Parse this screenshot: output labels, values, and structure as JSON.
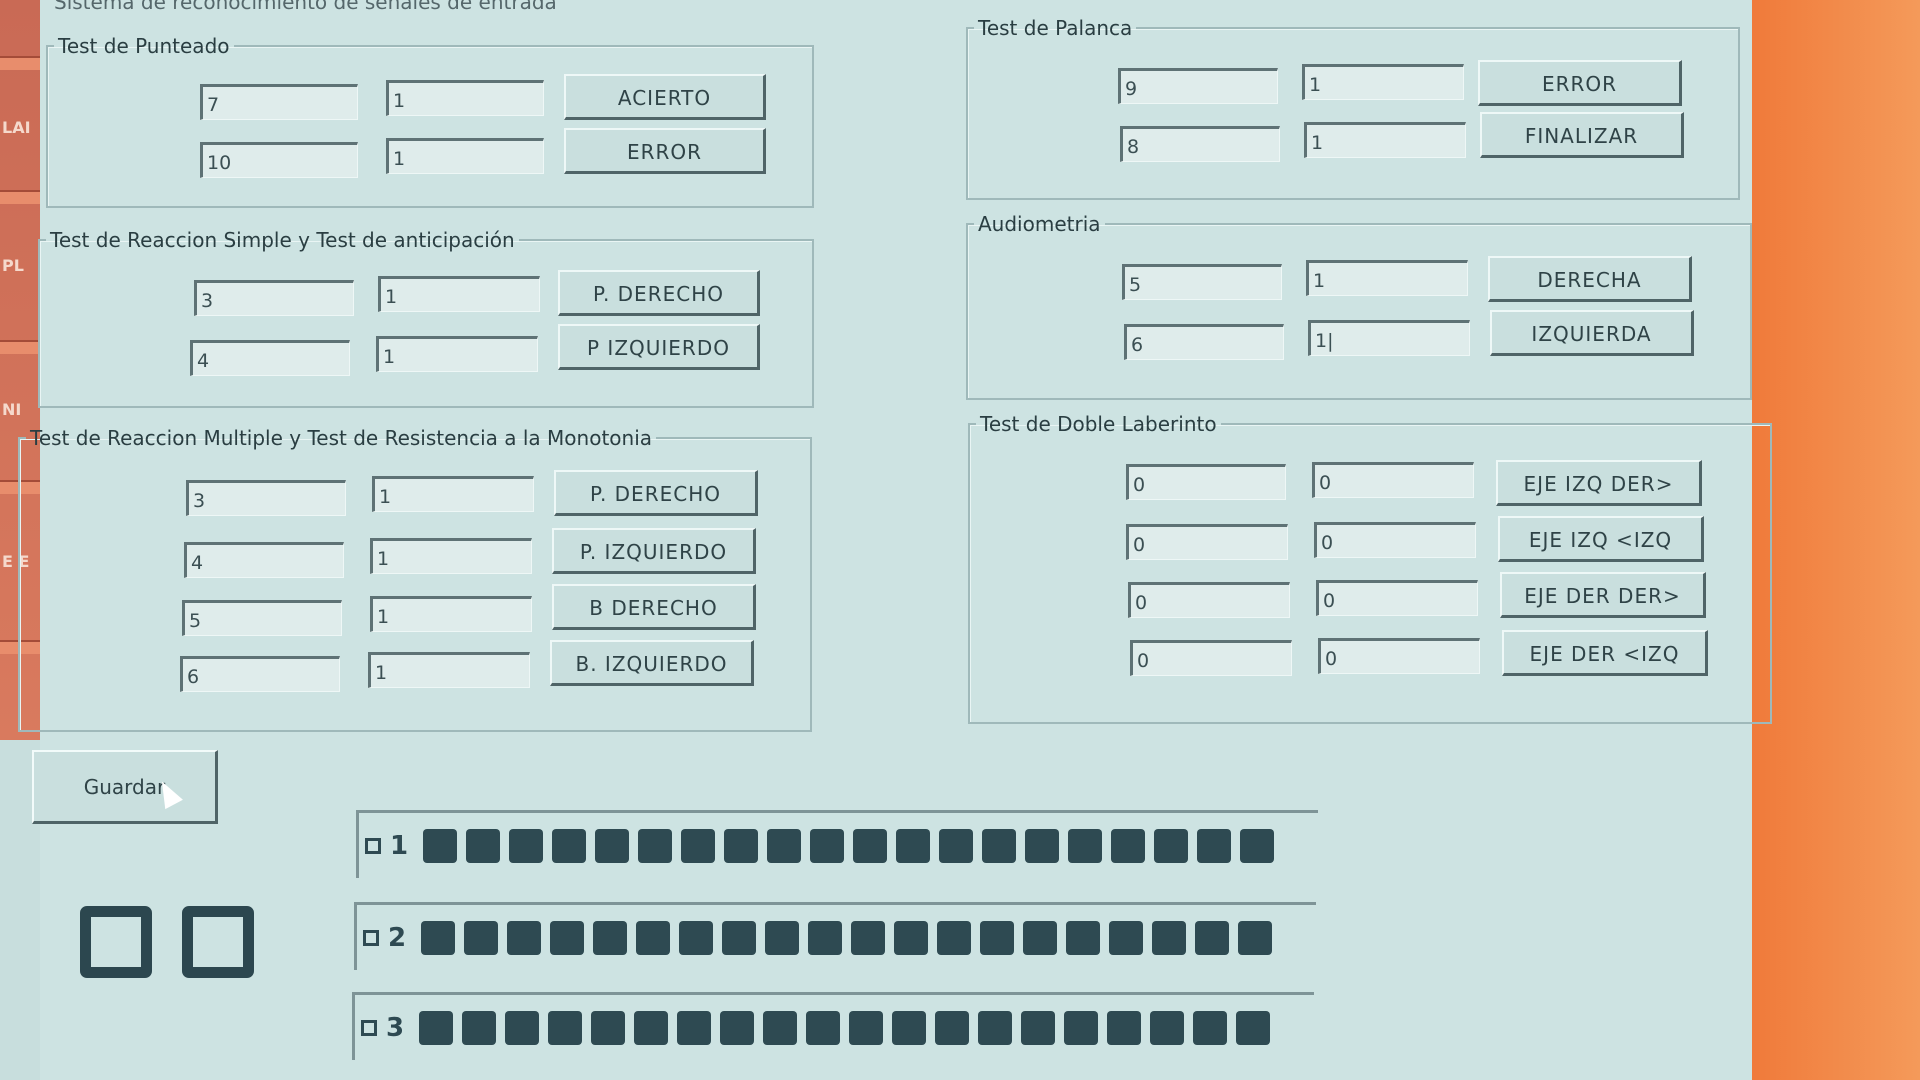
{
  "window": {
    "title": "Sistema de reconocimiento de señales de entrada"
  },
  "side_labels": [
    "LAI",
    "PL",
    "NI",
    "E E"
  ],
  "punteado": {
    "legend": "Test de Punteado",
    "rows": [
      {
        "v1": "7",
        "v2": "1",
        "button": "ACIERTO"
      },
      {
        "v1": "10",
        "v2": "1",
        "button": "ERROR"
      }
    ]
  },
  "reaccion_simple": {
    "legend": "Test de Reaccion Simple y Test de anticipación",
    "rows": [
      {
        "v1": "3",
        "v2": "1",
        "button": "P. DERECHO"
      },
      {
        "v1": "4",
        "v2": "1",
        "button": "P IZQUIERDO"
      }
    ]
  },
  "reaccion_multiple": {
    "legend": "Test de Reaccion Multiple y Test de Resistencia a la Monotonia",
    "rows": [
      {
        "v1": "3",
        "v2": "1",
        "button": "P. DERECHO"
      },
      {
        "v1": "4",
        "v2": "1",
        "button": "P. IZQUIERDO"
      },
      {
        "v1": "5",
        "v2": "1",
        "button": "B DERECHO"
      },
      {
        "v1": "6",
        "v2": "1",
        "button": "B. IZQUIERDO"
      }
    ]
  },
  "palanca": {
    "legend": "Test de Palanca",
    "rows": [
      {
        "v1": "9",
        "v2": "1",
        "button": "ERROR"
      },
      {
        "v1": "8",
        "v2": "1",
        "button": "FINALIZAR"
      }
    ]
  },
  "audiometria": {
    "legend": "Audiometria",
    "rows": [
      {
        "v1": "5",
        "v2": "1",
        "button": "DERECHA"
      },
      {
        "v1": "6",
        "v2": "1|",
        "button": "IZQUIERDA"
      }
    ]
  },
  "doble_laberinto": {
    "legend": "Test de Doble Laberinto",
    "rows": [
      {
        "v1": "0",
        "v2": "0",
        "button": "EJE IZQ DER>"
      },
      {
        "v1": "0",
        "v2": "0",
        "button": "EJE IZQ <IZQ"
      },
      {
        "v1": "0",
        "v2": "0",
        "button": "EJE DER DER>"
      },
      {
        "v1": "0",
        "v2": "0",
        "button": "EJE DER <IZQ"
      }
    ]
  },
  "guardar_label": "Guardar",
  "panels": [
    {
      "label": "1",
      "led_count": 20
    },
    {
      "label": "2",
      "led_count": 20
    },
    {
      "label": "3",
      "led_count": 20
    }
  ],
  "colors": {
    "background": "#cde3e2",
    "led": "#2e4a52",
    "accent": "#f07a3a"
  },
  "icons": [
    "checkbox-icon",
    "led-indicator-icon",
    "mouse-cursor-icon"
  ]
}
